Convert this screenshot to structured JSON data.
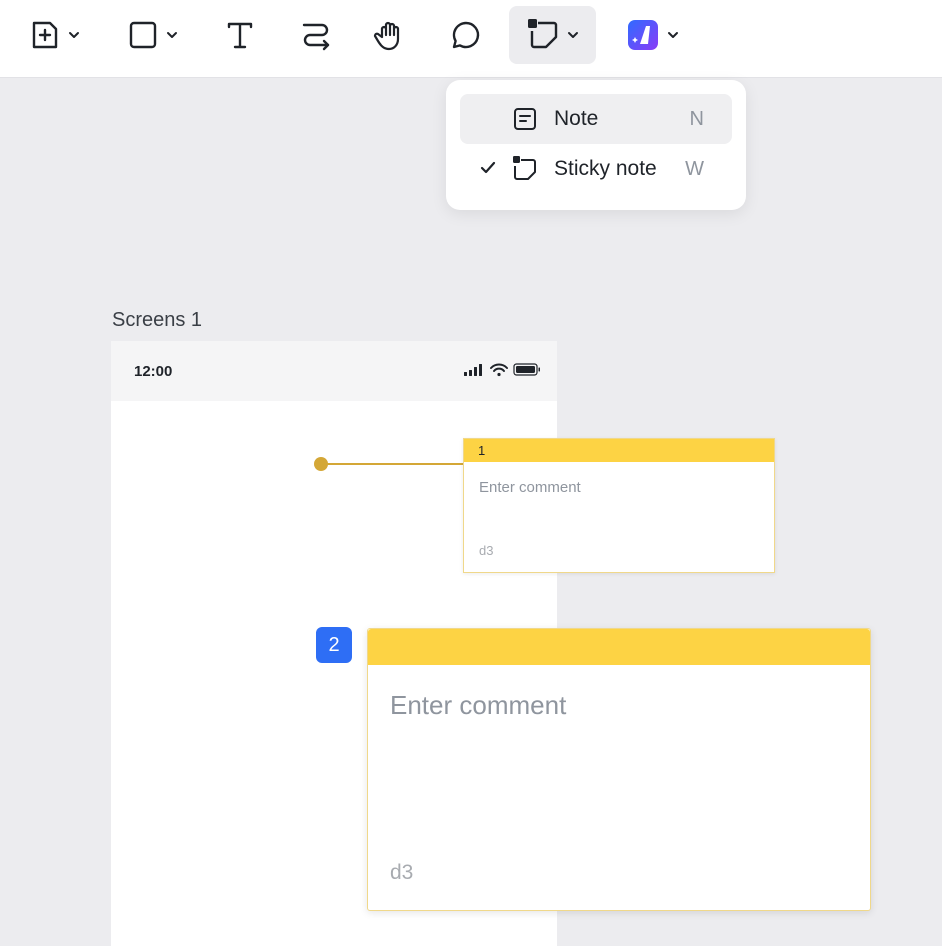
{
  "toolbar": {
    "tools": [
      {
        "name": "add-page-icon",
        "has_dropdown": true
      },
      {
        "name": "rectangle-icon",
        "has_dropdown": true
      },
      {
        "name": "text-icon",
        "has_dropdown": false
      },
      {
        "name": "connector-icon",
        "has_dropdown": false
      },
      {
        "name": "hand-icon",
        "has_dropdown": false
      },
      {
        "name": "comment-icon",
        "has_dropdown": false
      },
      {
        "name": "sticky-note-icon",
        "has_dropdown": true,
        "active": true
      },
      {
        "name": "ai-assistant-icon",
        "has_dropdown": true
      }
    ]
  },
  "menu": {
    "items": [
      {
        "label": "Note",
        "shortcut": "N",
        "icon": "note-icon",
        "checked": false
      },
      {
        "label": "Sticky note",
        "shortcut": "W",
        "icon": "sticky-note-icon",
        "checked": true
      }
    ]
  },
  "canvas": {
    "frame_title": "Screens 1",
    "status_time": "12:00",
    "note1": {
      "number": "1",
      "placeholder": "Enter comment",
      "author": "d3"
    },
    "note2": {
      "number": "2",
      "placeholder": "Enter comment",
      "author": "d3"
    }
  },
  "colors": {
    "accent_yellow": "#fdd344",
    "connector": "#d4a736",
    "badge_blue": "#2e6ef5",
    "ai_gradient_start": "#2f6bff",
    "ai_gradient_end": "#8b3cf7"
  }
}
